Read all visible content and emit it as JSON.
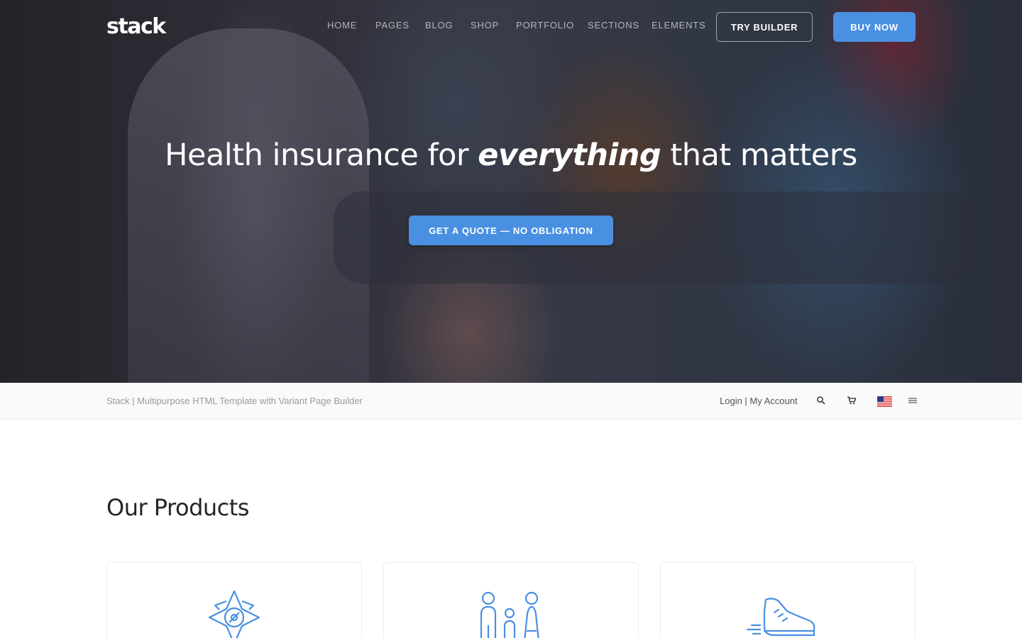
{
  "header": {
    "logo_text": "stack",
    "nav": [
      {
        "label": "Home"
      },
      {
        "label": "Pages"
      },
      {
        "label": "Blog"
      },
      {
        "label": "Shop"
      },
      {
        "label": "Portfolio"
      },
      {
        "label": "Sections"
      },
      {
        "label": "Elements"
      }
    ],
    "try_builder_label": "Try Builder",
    "buy_now_label": "Buy Now"
  },
  "hero": {
    "title_before": "Health insurance for",
    "title_emphasis": "everything",
    "title_after": "that matters",
    "cta_label": "Get a Quote — No Obligation"
  },
  "bar": {
    "tagline": "Stack | Multipurpose HTML Template with Variant Page Builder",
    "account_text": "Login | My Account",
    "icons": [
      "search-icon",
      "cart-icon",
      "us-flag-icon",
      "menu-icon"
    ]
  },
  "products": {
    "title": "Our Products",
    "cards": [
      {
        "icon": "compass-icon"
      },
      {
        "icon": "family-icon"
      },
      {
        "icon": "running-shoe-icon"
      }
    ]
  },
  "colors": {
    "accent": "#4a90e2",
    "bar_background": "#fafafa",
    "tagline_text": "#9a9a9a"
  }
}
